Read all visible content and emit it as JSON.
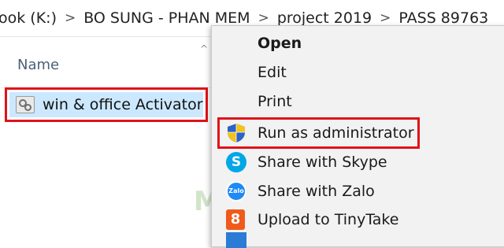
{
  "breadcrumb": {
    "items": [
      "ook (K:)",
      "BO SUNG - PHAN MEM",
      "project 2019",
      "PASS 89763"
    ],
    "separator": ">"
  },
  "file_pane": {
    "column_header": "Name",
    "sort_indicator": "^",
    "selected_file": {
      "name": "win & office Activator",
      "icon": "settings-shortcut-icon"
    }
  },
  "watermark": "M...",
  "context_menu": {
    "items": [
      {
        "label": "Open",
        "bold": true,
        "icon": ""
      },
      {
        "label": "Edit",
        "bold": false,
        "icon": ""
      },
      {
        "label": "Print",
        "bold": false,
        "icon": ""
      },
      {
        "label": "Run as administrator",
        "bold": false,
        "icon": "uac-shield-icon",
        "highlighted": true
      },
      {
        "label": "Share with Skype",
        "bold": false,
        "icon": "skype-icon",
        "icon_text": "S"
      },
      {
        "label": "Share with Zalo",
        "bold": false,
        "icon": "zalo-icon",
        "icon_text": "Zalo"
      },
      {
        "label": "Upload to TinyTake",
        "bold": false,
        "icon": "tinytake-icon",
        "icon_text": "8"
      }
    ]
  },
  "colors": {
    "highlight_border": "#e0121a",
    "selection_fill": "#cce8ff",
    "menu_background": "#f2f2f2"
  }
}
